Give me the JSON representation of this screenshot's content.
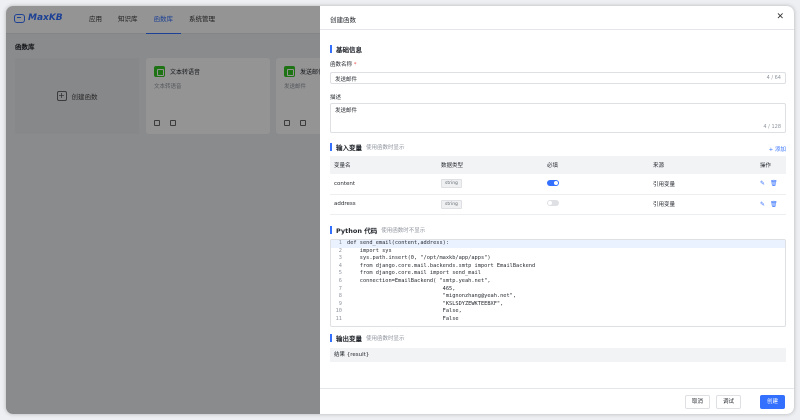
{
  "app": {
    "logo": "MaxKB",
    "nav": [
      "应用",
      "知识库",
      "函数库",
      "系统管理"
    ],
    "active_nav": "函数库",
    "page_title": "函数库",
    "create_label": "创建函数",
    "cards": [
      {
        "name": "文本转语音",
        "desc": "文本转语音"
      },
      {
        "name": "发送邮件",
        "desc": "发送邮件"
      }
    ]
  },
  "drawer": {
    "title": "创建函数",
    "basic": {
      "section": "基础信息",
      "name_label": "函数名称",
      "required_mark": "*",
      "name_value": "发送邮件",
      "name_count": "4 / 64",
      "desc_label": "描述",
      "desc_value": "发送邮件",
      "desc_count": "4 / 128"
    },
    "input": {
      "section": "输入变量",
      "hint": "使用函数时显示",
      "add_label": "+ 添加",
      "headers": [
        "变量名",
        "数据类型",
        "必填",
        "来源",
        "操作"
      ],
      "rows": [
        {
          "name": "content",
          "type": "string",
          "required": true,
          "source": "引用变量"
        },
        {
          "name": "address",
          "type": "string",
          "required": false,
          "source": "引用变量"
        }
      ]
    },
    "code": {
      "section": "Python 代码",
      "hint": "使用函数时不显示",
      "lines": [
        {
          "n": "1",
          "t": "def send_email(content,address):"
        },
        {
          "n": "2",
          "t": "    import sys"
        },
        {
          "n": "3",
          "t": "    sys.path.insert(0, \"/opt/maxkb/app/apps\")"
        },
        {
          "n": "4",
          "t": "    from django.core.mail.backends.smtp import EmailBackend"
        },
        {
          "n": "5",
          "t": "    from django.core.mail import send_mail"
        },
        {
          "n": "6",
          "t": "    connection=EmailBackend( \"smtp.yeah.net\","
        },
        {
          "n": "7",
          "t": "                              465,"
        },
        {
          "n": "8",
          "t": "                              \"mignonzhang@yeah.net\","
        },
        {
          "n": "9",
          "t": "                              \"KSLSDYZEWKTEEBXF\","
        },
        {
          "n": "10",
          "t": "                              False,"
        },
        {
          "n": "11",
          "t": "                              False"
        }
      ]
    },
    "output": {
      "section": "输出变量",
      "hint": "使用函数时显示",
      "row": "结果 {result}"
    },
    "footer": {
      "cancel": "取消",
      "debug": "调试",
      "create": "创建"
    }
  },
  "colors": {
    "accent": "#3370ff",
    "required": "#f54a45",
    "card_icon": "#34c724"
  }
}
